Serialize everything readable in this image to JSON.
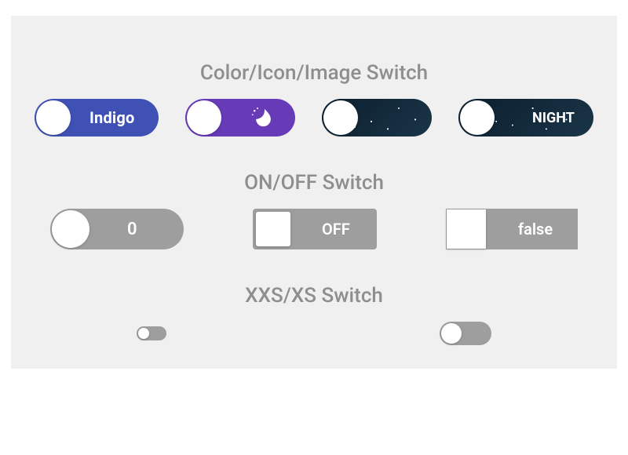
{
  "sections": {
    "color_icon_image": {
      "title": "Color/Icon/Image Switch"
    },
    "on_off": {
      "title": "ON/OFF Switch"
    },
    "xxs_xs": {
      "title": "XXS/XS Switch"
    }
  },
  "switches": {
    "indigo": {
      "label": "Indigo",
      "color": "#3f51b5",
      "on": false
    },
    "purple_moon": {
      "icon": "moon-stars-icon",
      "color": "#673ab7",
      "on": false
    },
    "starfield": {
      "background": "starfield",
      "on": false
    },
    "night": {
      "label": "NIGHT",
      "background": "starfield",
      "on": false
    },
    "zero": {
      "label": "0",
      "on": false
    },
    "off": {
      "label": "OFF",
      "on": false
    },
    "false": {
      "label": "false",
      "on": false
    },
    "xxs": {
      "on": false
    },
    "xs": {
      "on": false
    }
  },
  "colors": {
    "track_gray": "#9e9e9e",
    "title_gray": "#8e8e8e",
    "panel_bg": "#f0f0f0"
  }
}
